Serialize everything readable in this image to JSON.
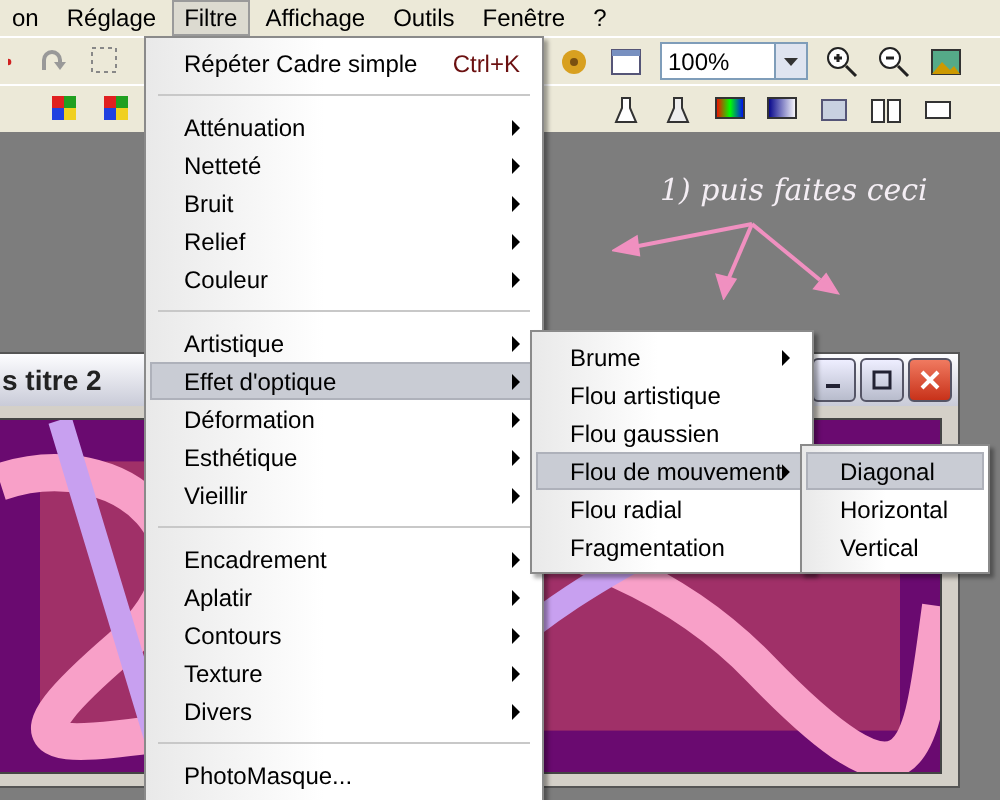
{
  "menubar": [
    {
      "label": "on",
      "selected": false
    },
    {
      "label": "Réglage",
      "selected": false
    },
    {
      "label": "Filtre",
      "selected": true
    },
    {
      "label": "Affichage",
      "selected": false
    },
    {
      "label": "Outils",
      "selected": false
    },
    {
      "label": "Fenêtre",
      "selected": false
    },
    {
      "label": "?",
      "selected": false
    }
  ],
  "toolbar": {
    "zoom_field": {
      "value": "100%"
    }
  },
  "annotation": "1) puis faites ceci",
  "document_window": {
    "title": "s titre 2"
  },
  "filter_menu": {
    "groups": [
      [
        {
          "label": "Répéter Cadre simple",
          "shortcut": "Ctrl+K",
          "submenu": false,
          "selected": false
        }
      ],
      [
        {
          "label": "Atténuation",
          "submenu": true,
          "selected": false
        },
        {
          "label": "Netteté",
          "submenu": true,
          "selected": false
        },
        {
          "label": "Bruit",
          "submenu": true,
          "selected": false
        },
        {
          "label": "Relief",
          "submenu": true,
          "selected": false
        },
        {
          "label": "Couleur",
          "submenu": true,
          "selected": false
        }
      ],
      [
        {
          "label": "Artistique",
          "submenu": true,
          "selected": false
        },
        {
          "label": "Effet d'optique",
          "submenu": true,
          "selected": true
        },
        {
          "label": "Déformation",
          "submenu": true,
          "selected": false
        },
        {
          "label": "Esthétique",
          "submenu": true,
          "selected": false
        },
        {
          "label": "Vieillir",
          "submenu": true,
          "selected": false
        }
      ],
      [
        {
          "label": "Encadrement",
          "submenu": true,
          "selected": false
        },
        {
          "label": "Aplatir",
          "submenu": true,
          "selected": false
        },
        {
          "label": "Contours",
          "submenu": true,
          "selected": false
        },
        {
          "label": "Texture",
          "submenu": true,
          "selected": false
        },
        {
          "label": "Divers",
          "submenu": true,
          "selected": false
        }
      ],
      [
        {
          "label": "PhotoMasque...",
          "submenu": false,
          "selected": false
        }
      ]
    ]
  },
  "optics_submenu": [
    {
      "label": "Brume",
      "submenu": true,
      "selected": false
    },
    {
      "label": "Flou artistique",
      "submenu": false,
      "selected": false
    },
    {
      "label": "Flou gaussien",
      "submenu": false,
      "selected": false
    },
    {
      "label": "Flou de mouvement",
      "submenu": true,
      "selected": true
    },
    {
      "label": "Flou radial",
      "submenu": false,
      "selected": false
    },
    {
      "label": "Fragmentation",
      "submenu": false,
      "selected": false
    }
  ],
  "motion_submenu": [
    {
      "label": "Diagonal",
      "selected": true
    },
    {
      "label": "Horizontal",
      "selected": false
    },
    {
      "label": "Vertical",
      "selected": false
    }
  ]
}
